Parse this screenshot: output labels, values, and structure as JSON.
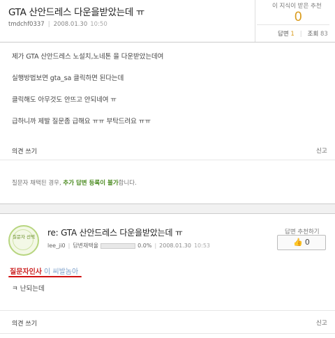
{
  "question": {
    "title": "GTA 산안드레스 다운을받았는데 ㅠ",
    "author": "tmdchf0337",
    "date": "2008.01.30",
    "time": "10:50",
    "recommend_label": "이 지식이 받은 추천",
    "recommend_count": "0",
    "answers_label": "답변",
    "answers_count": "1",
    "views_label": "조회",
    "views_count": "83",
    "body_lines": [
      "제가 GTA 산안드레스 노설치,노네톤 을 다운받았는데여",
      "실행방법보면 gta_sa 클릭하면 된다는데",
      "클릭해도 아무것도 안뜨고 안되네여 ㅠ",
      "급하니까 제발 질문좀 급해요 ㅠㅠ 부탁드려요 ㅠㅠ"
    ],
    "opinion_link": "의견 쓰기",
    "report_link": "신고",
    "notice_prefix": "질문자 채택된 경우,",
    "notice_highlight": "추가 답변 등록이 불가",
    "notice_suffix": "합니다."
  },
  "answer": {
    "badge_text": "질문자 선택",
    "title": "re: GTA 산안드레스 다운을받았는데 ㅠ",
    "author": "lee_ji0",
    "adopt_label": "답변채택율",
    "adopt_rate": "0.0%",
    "date": "2008.01.30",
    "time": "10:53",
    "recommend_label": "답변 추천하기",
    "recommend_count": "0",
    "greeting_label": "질문자인사",
    "greeting_text": "이 씨발놈아",
    "body": "ㅋ 난되는데",
    "opinion_link": "의견 쓰기",
    "report_link": "신고"
  },
  "colors": {
    "accent_orange": "#d99a1a",
    "highlight_green": "#4a8a1f",
    "greeting_red": "#cc2222",
    "underline_red": "#d01010"
  }
}
